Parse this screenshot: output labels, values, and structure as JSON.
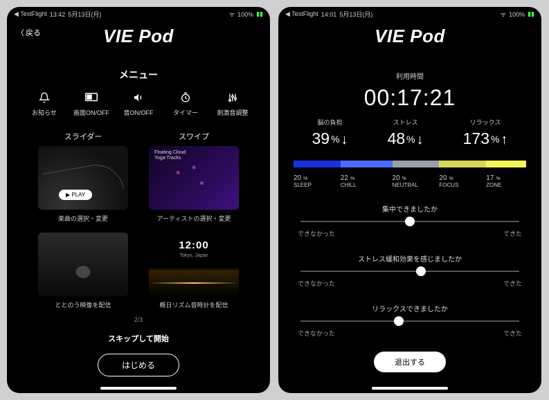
{
  "status_bar_left": {
    "app_indicator": "◀ TestFlight",
    "time": "13:42",
    "date": "5月13日(月)"
  },
  "status_bar_left_right": {
    "time": "14:01",
    "date": "5月13日(月)"
  },
  "status_bar_right": {
    "battery": "100%"
  },
  "logo_text": "VIE Pod",
  "left": {
    "back_label": "戻る",
    "menu_title": "メニュー",
    "menu_items": [
      {
        "label": "お知らせ"
      },
      {
        "label": "画面ON/OFF"
      },
      {
        "label": "音ON/OFF"
      },
      {
        "label": "タイマー"
      },
      {
        "label": "刺激音調整"
      }
    ],
    "cards": {
      "slider_head": "スライダー",
      "swipe_head": "スワイプ",
      "slider_caption": "楽曲の選択・変更",
      "swipe_title1": "Floating Cloud",
      "swipe_title2": "Yoga Tracks",
      "swipe_caption": "アーティストの選択・変更",
      "play_label": "PLAY",
      "video_caption": "ととのう映像を配信",
      "clock_time": "12:00",
      "clock_location": "Tokyo, Japan",
      "clock_caption": "概日リズム音時計を配信"
    },
    "pager": "2/3",
    "skip_label": "スキップして開始",
    "start_label": "はじめる"
  },
  "right": {
    "usage_label": "利用時間",
    "timer": "00:17:21",
    "metrics": [
      {
        "label": "脳の負担",
        "value": "39",
        "unit": "%",
        "dir": "down"
      },
      {
        "label": "ストレス",
        "value": "48",
        "unit": "%",
        "dir": "down"
      },
      {
        "label": "リラックス",
        "value": "173",
        "unit": "%",
        "dir": "up"
      }
    ],
    "spectrum": [
      {
        "pct": 20,
        "label": "SLEEP",
        "color": "#1a2fe0"
      },
      {
        "pct": 22,
        "label": "CHILL",
        "color": "#4a6bff"
      },
      {
        "pct": 20,
        "label": "NEUTRAL",
        "color": "#9aa0a8"
      },
      {
        "pct": 20,
        "label": "FOCUS",
        "color": "#d8d85a"
      },
      {
        "pct": 17,
        "label": "ZONE",
        "color": "#f5f55a"
      }
    ],
    "questions": [
      {
        "text": "集中できましたか",
        "low": "できなかった",
        "high": "できた",
        "pos": 50
      },
      {
        "text": "ストレス緩和効果を感じましたか",
        "low": "できなかった",
        "high": "できた",
        "pos": 55
      },
      {
        "text": "リラックスできましたか",
        "low": "できなかった",
        "high": "できた",
        "pos": 45
      }
    ],
    "submit_label": "退出する"
  }
}
